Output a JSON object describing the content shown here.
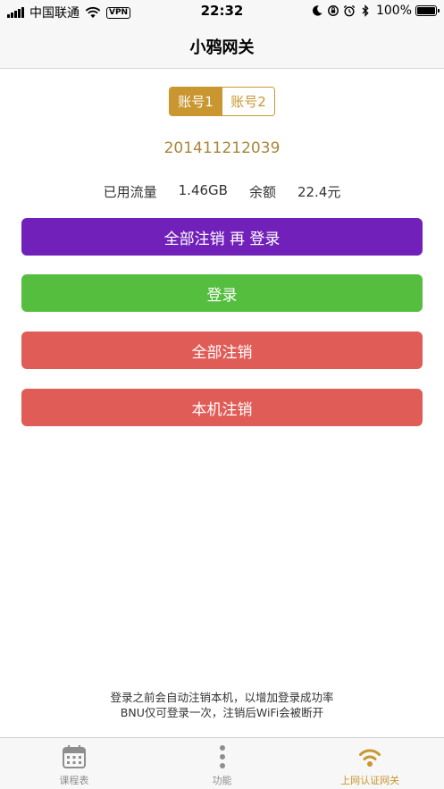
{
  "status_bar": {
    "carrier": "中国联通",
    "vpn": "VPN",
    "time": "22:32",
    "battery": "100%"
  },
  "nav": {
    "title": "小鸦网关"
  },
  "accounts": {
    "tabs": [
      {
        "label": "账号1",
        "active": true
      },
      {
        "label": "账号2",
        "active": false
      }
    ]
  },
  "account_id": "201411212039",
  "usage": {
    "used_label": "已用流量",
    "used_value": "1.46GB",
    "balance_label": "余额",
    "balance_value": "22.4元"
  },
  "buttons": {
    "relogin": "全部注销 再 登录",
    "login": "登录",
    "logout_all": "全部注销",
    "logout_this": "本机注销"
  },
  "colors": {
    "accent": "#c9962f",
    "relogin": "#7121b9",
    "login": "#56be3f",
    "logout": "#e05c57"
  },
  "notice": {
    "line1": "登录之前会自动注销本机，以增加登录成功率",
    "line2": "BNU仅可登录一次，注销后WiFi会被断开"
  },
  "tab_bar": {
    "items": [
      {
        "label": "课程表",
        "icon": "calendar-icon",
        "active": false
      },
      {
        "label": "功能",
        "icon": "more-vertical-icon",
        "active": false
      },
      {
        "label": "上网认证网关",
        "icon": "wifi-icon",
        "active": true
      }
    ]
  }
}
